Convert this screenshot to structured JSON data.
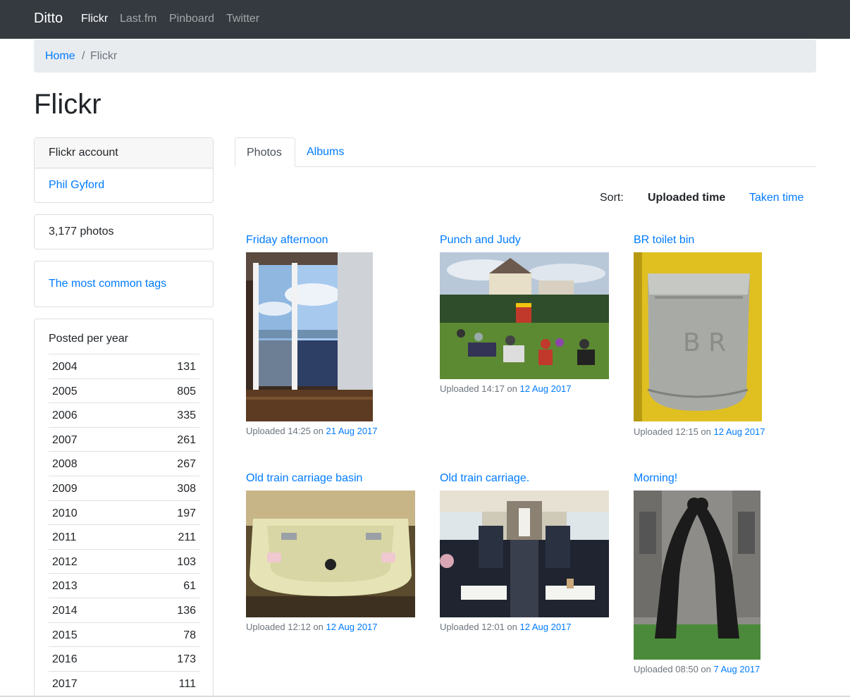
{
  "navbar": {
    "brand": "Ditto",
    "links": [
      {
        "label": "Flickr",
        "active": true
      },
      {
        "label": "Last.fm",
        "active": false
      },
      {
        "label": "Pinboard",
        "active": false
      },
      {
        "label": "Twitter",
        "active": false
      }
    ]
  },
  "breadcrumb": {
    "home": "Home",
    "separator": "/",
    "current": "Flickr"
  },
  "page_title": "Flickr",
  "sidebar": {
    "account_header": "Flickr account",
    "account_name": "Phil Gyford",
    "photo_count": "3,177 photos",
    "tags_link": "The most common tags",
    "years_title": "Posted per year",
    "years": [
      {
        "year": "2004",
        "count": "131"
      },
      {
        "year": "2005",
        "count": "805"
      },
      {
        "year": "2006",
        "count": "335"
      },
      {
        "year": "2007",
        "count": "261"
      },
      {
        "year": "2008",
        "count": "267"
      },
      {
        "year": "2009",
        "count": "308"
      },
      {
        "year": "2010",
        "count": "197"
      },
      {
        "year": "2011",
        "count": "211"
      },
      {
        "year": "2012",
        "count": "103"
      },
      {
        "year": "2013",
        "count": "61"
      },
      {
        "year": "2014",
        "count": "136"
      },
      {
        "year": "2015",
        "count": "78"
      },
      {
        "year": "2016",
        "count": "173"
      },
      {
        "year": "2017",
        "count": "111"
      }
    ]
  },
  "tabs": {
    "photos": "Photos",
    "albums": "Albums"
  },
  "sort": {
    "label": "Sort:",
    "active": "Uploaded time",
    "other": "Taken time"
  },
  "photos": [
    {
      "title": "Friday afternoon",
      "meta_prefix": "Uploaded 14:25 on",
      "date": "21 Aug 2017"
    },
    {
      "title": "Punch and Judy",
      "meta_prefix": "Uploaded 14:17 on",
      "date": "12 Aug 2017"
    },
    {
      "title": "BR toilet bin",
      "meta_prefix": "Uploaded 12:15 on",
      "date": "12 Aug 2017"
    },
    {
      "title": "Old train carriage basin",
      "meta_prefix": "Uploaded 12:12 on",
      "date": "12 Aug 2017"
    },
    {
      "title": "Old train carriage.",
      "meta_prefix": "Uploaded 12:01 on",
      "date": "12 Aug 2017"
    },
    {
      "title": "Morning!",
      "meta_prefix": "Uploaded 08:50 on",
      "date": "7 Aug 2017"
    }
  ],
  "colors": {
    "navbar_bg": "#343a40",
    "link": "#007bff",
    "muted": "#6c757d",
    "breadcrumb_bg": "#e9ecef"
  }
}
